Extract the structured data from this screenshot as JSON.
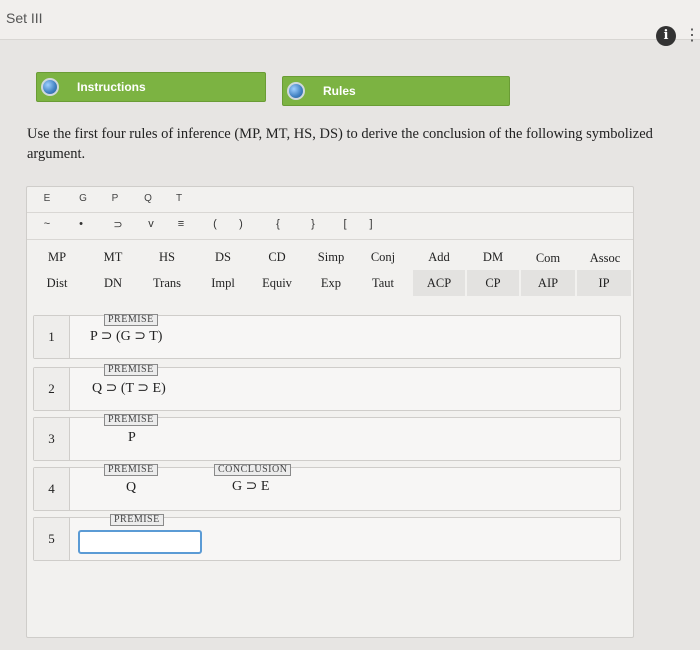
{
  "header": {
    "set_title": "Set III",
    "info_label": "i"
  },
  "panels": {
    "instructions": "Instructions",
    "rules": "Rules"
  },
  "question": "Use the first four rules of inference (MP, MT, HS, DS) to derive the conclusion of the following symbolized argument.",
  "variables": [
    "E",
    "G",
    "P",
    "Q",
    "T"
  ],
  "symbols": [
    "~",
    "•",
    "⊃",
    "v",
    "≡",
    "(",
    ")",
    "{",
    "}",
    "[",
    "]"
  ],
  "rules_row1": [
    "MP",
    "MT",
    "HS",
    "DS",
    "CD",
    "Simp",
    "Conj",
    "Add",
    "DM",
    "Com",
    "Assoc"
  ],
  "rules_row2": [
    "Dist",
    "DN",
    "Trans",
    "Impl",
    "Equiv",
    "Exp",
    "Taut",
    "ACP",
    "CP",
    "AIP",
    "IP"
  ],
  "lines": [
    {
      "num": "1",
      "tag": "PREMISE",
      "formula": "P ⊃ (G ⊃ T)"
    },
    {
      "num": "2",
      "tag": "PREMISE",
      "formula": "Q ⊃ (T ⊃ E)"
    },
    {
      "num": "3",
      "tag": "PREMISE",
      "formula": "P"
    },
    {
      "num": "4",
      "tag": "PREMISE",
      "formula": "Q",
      "conclusion_tag": "CONCLUSION",
      "conclusion": "G ⊃ E"
    },
    {
      "num": "5",
      "tag": "PREMISE",
      "input_value": ""
    }
  ]
}
